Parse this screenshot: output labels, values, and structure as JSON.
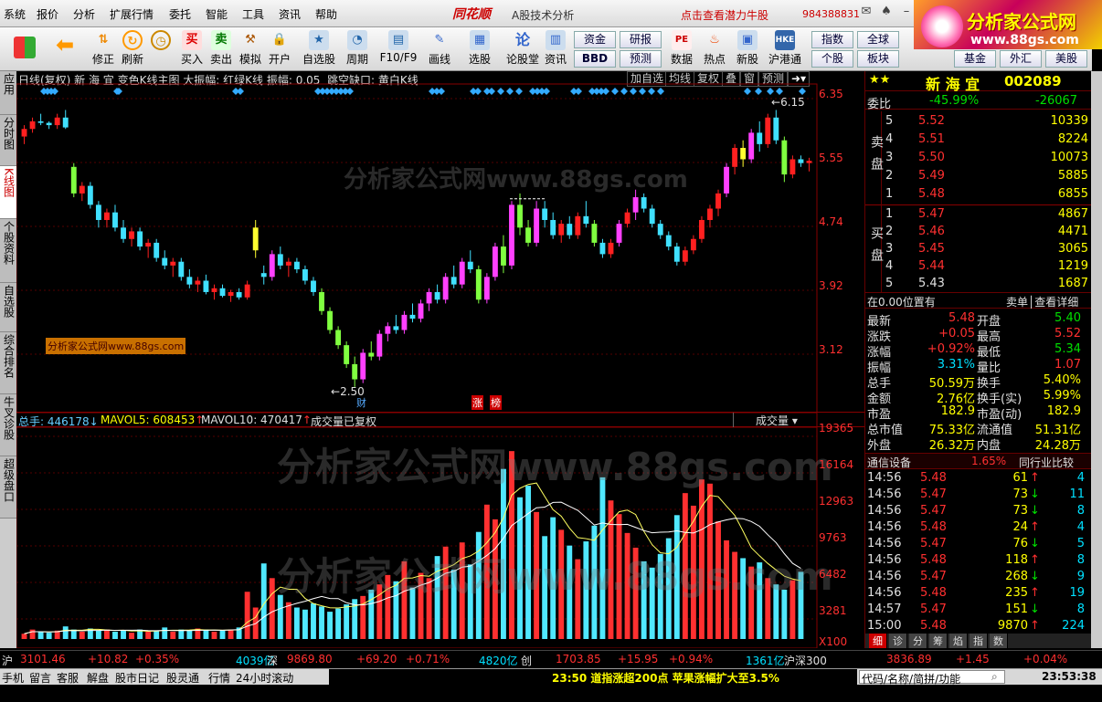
{
  "menu": {
    "items": [
      "系统",
      "报价",
      "分析",
      "扩展行情",
      "委托",
      "智能",
      "工具",
      "资讯",
      "帮助"
    ],
    "brand": "同花顺",
    "title": "A股技术分析",
    "promo": "点击查看潜力牛股",
    "account": "984388831"
  },
  "toolbar": {
    "buttons": [
      "修正",
      "刷新",
      "买入",
      "卖出",
      "模拟",
      "开户",
      "自选股",
      "周期",
      "F10/F9",
      "画线",
      "选股",
      "论股堂",
      "资讯",
      "数据",
      "热点",
      "新股",
      "沪港通"
    ],
    "small": [
      "资金",
      "研报",
      "BBD",
      "预测",
      "指数",
      "全球",
      "个股",
      "板块",
      "基金",
      "外汇",
      "美股"
    ]
  },
  "logo": {
    "line1": "分析家公式网",
    "line2": "www.88gs.com"
  },
  "lefttabs": [
    "应用",
    "分时图",
    "K线图",
    "个股资料",
    "自选股",
    "综合排名",
    "牛叉诊股",
    "超级盘口"
  ],
  "chart": {
    "header": "日线(复权)  新 海 宜  变色K线主图  大振幅: 红绿K线  振幅: 0.05",
    "gap_label": "跳空缺口: 黄白K线",
    "buttons": [
      "加自选",
      "均线",
      "复权",
      "叠",
      "窗",
      "预测"
    ],
    "high_label": "6.15",
    "low_label": "2.50",
    "event_labels": [
      "财",
      "涨",
      "榜"
    ],
    "price_ticks": [
      "6.35",
      "5.55",
      "4.74",
      "3.92",
      "3.12"
    ],
    "vol_header": {
      "total": "总手: 446178",
      "mavol5": "MAVOL5: 608453",
      "mavol10": "MAVOL10: 470417",
      "note": "成交量已复权",
      "dropdown": "成交量"
    },
    "vol_ticks": [
      "19365",
      "16164",
      "12963",
      "9763",
      "6482",
      "3281",
      "X100"
    ],
    "watermark_big": "分析家公式网www.88gs.com",
    "watermark_small": "分析家公式网www.88gs.com"
  },
  "chart_data": {
    "type": "candlestick",
    "price_range": [
      2.5,
      6.35
    ],
    "candles": [
      [
        5.8,
        5.95,
        5.7,
        5.9
      ],
      [
        5.9,
        6.05,
        5.85,
        6.0
      ],
      [
        6.0,
        6.1,
        5.95,
        5.98
      ],
      [
        5.98,
        6.0,
        5.9,
        5.95
      ],
      [
        5.95,
        6.1,
        5.9,
        6.05
      ],
      [
        6.05,
        6.15,
        5.9,
        5.92
      ],
      [
        5.4,
        5.45,
        5.0,
        5.05
      ],
      [
        5.05,
        5.2,
        4.95,
        5.15
      ],
      [
        5.15,
        5.2,
        4.85,
        4.9
      ],
      [
        4.9,
        4.95,
        4.6,
        4.7
      ],
      [
        4.7,
        4.85,
        4.6,
        4.8
      ],
      [
        4.8,
        4.9,
        4.55,
        4.6
      ],
      [
        4.6,
        4.7,
        4.4,
        4.45
      ],
      [
        4.45,
        4.6,
        4.35,
        4.55
      ],
      [
        4.55,
        4.6,
        4.3,
        4.35
      ],
      [
        4.35,
        4.45,
        4.2,
        4.4
      ],
      [
        4.4,
        4.45,
        4.15,
        4.2
      ],
      [
        4.2,
        4.3,
        4.05,
        4.1
      ],
      [
        4.1,
        4.2,
        3.95,
        4.15
      ],
      [
        4.15,
        4.2,
        3.9,
        3.95
      ],
      [
        3.95,
        4.05,
        3.8,
        3.85
      ],
      [
        3.85,
        3.95,
        3.75,
        3.9
      ],
      [
        3.9,
        3.98,
        3.72,
        3.75
      ],
      [
        3.75,
        3.85,
        3.65,
        3.8
      ],
      [
        3.8,
        3.85,
        3.68,
        3.7
      ],
      [
        3.7,
        3.78,
        3.62,
        3.75
      ],
      [
        3.75,
        3.8,
        3.65,
        3.68
      ],
      [
        3.68,
        3.9,
        3.65,
        3.85
      ],
      [
        4.3,
        4.7,
        4.2,
        4.6
      ],
      [
        4.0,
        4.1,
        3.85,
        3.95
      ],
      [
        3.95,
        4.3,
        3.9,
        4.25
      ],
      [
        4.25,
        4.35,
        4.05,
        4.1
      ],
      [
        4.1,
        4.2,
        3.95,
        4.15
      ],
      [
        4.15,
        4.2,
        4.0,
        4.05
      ],
      [
        4.05,
        4.1,
        3.85,
        3.9
      ],
      [
        3.9,
        3.95,
        3.7,
        3.75
      ],
      [
        3.75,
        3.8,
        3.45,
        3.5
      ],
      [
        3.5,
        3.55,
        3.2,
        3.25
      ],
      [
        3.25,
        3.3,
        3.0,
        3.05
      ],
      [
        3.05,
        3.1,
        2.75,
        2.8
      ],
      [
        2.8,
        2.9,
        2.5,
        2.6
      ],
      [
        2.6,
        3.0,
        2.55,
        2.95
      ],
      [
        2.95,
        3.1,
        2.85,
        2.9
      ],
      [
        2.9,
        3.25,
        2.85,
        3.2
      ],
      [
        3.2,
        3.35,
        3.1,
        3.3
      ],
      [
        3.3,
        3.45,
        3.2,
        3.25
      ],
      [
        3.25,
        3.5,
        3.2,
        3.45
      ],
      [
        3.45,
        3.6,
        3.35,
        3.4
      ],
      [
        3.4,
        3.65,
        3.35,
        3.6
      ],
      [
        3.6,
        3.8,
        3.5,
        3.75
      ],
      [
        3.75,
        3.85,
        3.6,
        3.65
      ],
      [
        3.65,
        4.0,
        3.6,
        3.95
      ],
      [
        3.95,
        4.1,
        3.8,
        3.85
      ],
      [
        3.85,
        4.2,
        3.8,
        4.15
      ],
      [
        4.15,
        4.3,
        4.0,
        4.05
      ],
      [
        4.05,
        4.1,
        3.6,
        3.65
      ],
      [
        3.65,
        4.0,
        3.6,
        3.95
      ],
      [
        3.95,
        4.4,
        3.9,
        4.35
      ],
      [
        4.35,
        4.5,
        4.0,
        4.1
      ],
      [
        4.1,
        4.95,
        4.05,
        4.9
      ],
      [
        4.9,
        5.05,
        4.5,
        4.6
      ],
      [
        4.6,
        4.7,
        4.35,
        4.4
      ],
      [
        4.4,
        4.95,
        4.35,
        4.85
      ],
      [
        4.85,
        4.95,
        4.6,
        4.7
      ],
      [
        4.7,
        4.8,
        4.45,
        4.5
      ],
      [
        4.5,
        4.7,
        4.4,
        4.65
      ],
      [
        4.65,
        4.75,
        4.45,
        4.5
      ],
      [
        4.5,
        4.8,
        4.45,
        4.75
      ],
      [
        4.75,
        4.95,
        4.6,
        4.65
      ],
      [
        4.65,
        4.7,
        4.35,
        4.4
      ],
      [
        4.4,
        4.45,
        4.2,
        4.25
      ],
      [
        4.25,
        4.45,
        4.2,
        4.4
      ],
      [
        4.4,
        4.7,
        4.35,
        4.65
      ],
      [
        4.65,
        4.85,
        4.6,
        4.8
      ],
      [
        4.8,
        5.1,
        4.7,
        5.0
      ],
      [
        5.0,
        5.05,
        4.8,
        4.85
      ],
      [
        4.85,
        4.9,
        4.6,
        4.65
      ],
      [
        4.65,
        4.7,
        4.45,
        4.5
      ],
      [
        4.5,
        4.55,
        4.3,
        4.35
      ],
      [
        4.35,
        4.4,
        4.1,
        4.15
      ],
      [
        4.15,
        4.35,
        4.1,
        4.3
      ],
      [
        4.3,
        4.5,
        4.25,
        4.45
      ],
      [
        4.45,
        4.75,
        4.4,
        4.7
      ],
      [
        4.7,
        4.9,
        4.6,
        4.85
      ],
      [
        4.85,
        5.1,
        4.75,
        5.05
      ],
      [
        5.05,
        5.45,
        5.0,
        5.4
      ],
      [
        5.4,
        5.7,
        5.3,
        5.65
      ],
      [
        5.65,
        5.75,
        5.4,
        5.5
      ],
      [
        5.5,
        5.9,
        5.45,
        5.85
      ],
      [
        5.85,
        6.0,
        5.6,
        5.7
      ],
      [
        5.7,
        6.1,
        5.65,
        6.05
      ],
      [
        6.05,
        6.15,
        5.7,
        5.75
      ],
      [
        5.75,
        5.8,
        5.2,
        5.3
      ],
      [
        5.3,
        5.55,
        5.25,
        5.5
      ],
      [
        5.5,
        5.55,
        5.4,
        5.45
      ],
      [
        5.45,
        5.52,
        5.34,
        5.48
      ]
    ],
    "volumes": [
      500,
      900,
      700,
      600,
      800,
      1200,
      900,
      700,
      1000,
      800,
      900,
      700,
      800,
      600,
      900,
      700,
      800,
      1100,
      700,
      900,
      800,
      1000,
      900,
      700,
      800,
      900,
      1100,
      4500,
      3000,
      7200,
      5800,
      4200,
      3500,
      3000,
      2800,
      3400,
      3100,
      2600,
      2900,
      3300,
      3800,
      4100,
      4700,
      5200,
      6100,
      5500,
      7400,
      4900,
      6300,
      5800,
      7900,
      8800,
      6600,
      9200,
      7100,
      10200,
      12800,
      11400,
      16200,
      17900,
      13500,
      14600,
      12100,
      9800,
      11600,
      10400,
      8900,
      7600,
      9300,
      10800,
      15400,
      13200,
      11900,
      10100,
      8700,
      7400,
      6800,
      8100,
      9600,
      11800,
      13900,
      12700,
      15200,
      14800,
      11200,
      9400,
      8300,
      7700,
      6900,
      7300,
      5800,
      5200,
      4700,
      5600,
      6400
    ],
    "mavol5_label": "MAVOL5",
    "mavol10_label": "MAVOL10"
  },
  "quote": {
    "name": "新 海 宜",
    "code": "002089",
    "weibi_label": "委比",
    "weibi": "-45.99%",
    "weicha": "-26067",
    "sell_label": "卖盘",
    "buy_label": "买盘",
    "sells": [
      {
        "lvl": "5",
        "price": "5.52",
        "vol": "10339"
      },
      {
        "lvl": "4",
        "price": "5.51",
        "vol": "8224"
      },
      {
        "lvl": "3",
        "price": "5.50",
        "vol": "10073"
      },
      {
        "lvl": "2",
        "price": "5.49",
        "vol": "5885"
      },
      {
        "lvl": "1",
        "price": "5.48",
        "vol": "6855"
      }
    ],
    "buys": [
      {
        "lvl": "1",
        "price": "5.47",
        "vol": "4867"
      },
      {
        "lvl": "2",
        "price": "5.46",
        "vol": "4471"
      },
      {
        "lvl": "3",
        "price": "5.45",
        "vol": "3065"
      },
      {
        "lvl": "4",
        "price": "5.44",
        "vol": "1219"
      },
      {
        "lvl": "5",
        "price": "5.43",
        "vol": "1687"
      }
    ],
    "position": "在0.00位置有",
    "detail": "卖单│查看详细",
    "stats": [
      [
        "最新",
        "5.48",
        "开盘",
        "5.40"
      ],
      [
        "涨跌",
        "+0.05",
        "最高",
        "5.52"
      ],
      [
        "涨幅",
        "+0.92%",
        "最低",
        "5.34"
      ],
      [
        "振幅",
        "3.31%",
        "量比",
        "1.07"
      ],
      [
        "总手",
        "50.59万",
        "换手",
        "5.40%"
      ],
      [
        "金额",
        "2.76亿",
        "换手(实)",
        "5.99%"
      ],
      [
        "市盈",
        "182.9",
        "市盈(动)",
        "182.9"
      ],
      [
        "总市值",
        "75.33亿",
        "流通值",
        "51.31亿"
      ],
      [
        "外盘",
        "26.32万",
        "内盘",
        "24.28万"
      ]
    ],
    "industry": "通信设备",
    "industry_pct": "1.65%",
    "compare": "同行业比较",
    "ticks": [
      [
        "14:56",
        "5.48",
        "61",
        "↑",
        "4"
      ],
      [
        "14:56",
        "5.47",
        "73",
        "↓",
        "11"
      ],
      [
        "14:56",
        "5.47",
        "73",
        "↓",
        "8"
      ],
      [
        "14:56",
        "5.48",
        "24",
        "↑",
        "4"
      ],
      [
        "14:56",
        "5.47",
        "76",
        "↓",
        "5"
      ],
      [
        "14:56",
        "5.48",
        "118",
        "↑",
        "8"
      ],
      [
        "14:56",
        "5.47",
        "268",
        "↓",
        "9"
      ],
      [
        "14:56",
        "5.48",
        "235",
        "↑",
        "19"
      ],
      [
        "14:57",
        "5.47",
        "151",
        "↓",
        "8"
      ],
      [
        "15:00",
        "5.48",
        "9870",
        "↑",
        "224"
      ]
    ],
    "tabs": [
      "细",
      "诊",
      "分",
      "筹",
      "焰",
      "指",
      "数"
    ]
  },
  "status": {
    "sh_label": "沪",
    "sh": "3101.46",
    "sh_chg": "+10.82",
    "sh_pct": "+0.35%",
    "sh_amt": "4039亿",
    "sz_label": "深",
    "sz": "9869.80",
    "sz_chg": "+69.20",
    "sz_pct": "+0.71%",
    "sz_amt": "4820亿",
    "cy_label": "创",
    "cy": "1703.85",
    "cy_chg": "+15.95",
    "cy_pct": "+0.94%",
    "cy_amt": "1361亿",
    "hs_label": "沪深300",
    "hs": "3836.89",
    "hs_chg": "+1.45",
    "hs_pct": "+0.04%"
  },
  "bottom": {
    "items": [
      "手机",
      "留言",
      "客服",
      "解盘",
      "股市日记",
      "股灵通",
      "行情",
      "24小时滚动"
    ],
    "news": "23:50 道指涨超200点   苹果涨幅扩大至3.5%",
    "search_placeholder": "代码/名称/简拼/功能",
    "clock": "23:53:38"
  }
}
